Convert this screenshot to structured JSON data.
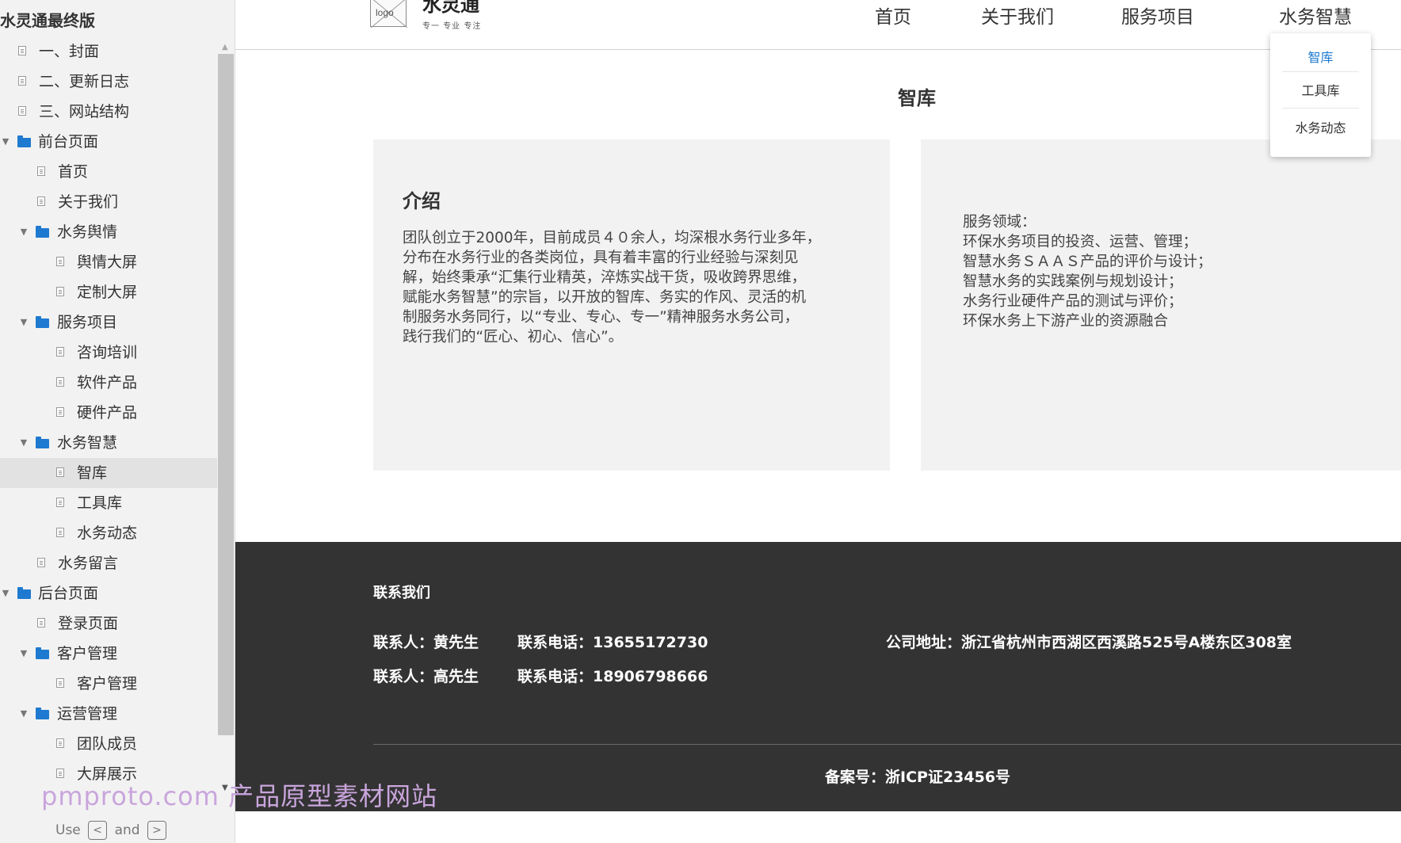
{
  "sidebar": {
    "title": "水灵通最终版",
    "items": [
      {
        "label": "一、封面"
      },
      {
        "label": "二、更新日志"
      },
      {
        "label": "三、网站结构"
      },
      {
        "label": "前台页面"
      },
      {
        "label": "首页"
      },
      {
        "label": "关于我们"
      },
      {
        "label": "水务舆情"
      },
      {
        "label": "舆情大屏"
      },
      {
        "label": "定制大屏"
      },
      {
        "label": "服务项目"
      },
      {
        "label": "咨询培训"
      },
      {
        "label": "软件产品"
      },
      {
        "label": "硬件产品"
      },
      {
        "label": "水务智慧"
      },
      {
        "label": "智库"
      },
      {
        "label": "工具库"
      },
      {
        "label": "水务动态"
      },
      {
        "label": "水务留言"
      },
      {
        "label": "后台页面"
      },
      {
        "label": "登录页面"
      },
      {
        "label": "客户管理"
      },
      {
        "label": "客户管理"
      },
      {
        "label": "运营管理"
      },
      {
        "label": "团队成员"
      },
      {
        "label": "大屏展示"
      }
    ],
    "active_item": "智库",
    "hint": {
      "use": "Use",
      "and": "and",
      "key_prev": "<",
      "key_next": ">"
    }
  },
  "watermark": "pmproto.com 产品原型素材网站",
  "header": {
    "logo_text": "logo",
    "brand_name": "水灵通",
    "slogan": "专一 专业 专注",
    "nav": [
      {
        "label": "首页"
      },
      {
        "label": "关于我们"
      },
      {
        "label": "服务项目"
      },
      {
        "label": "水务智慧"
      }
    ],
    "dropdown": [
      {
        "label": "智库",
        "active": true
      },
      {
        "label": "工具库"
      },
      {
        "label": "水务动态"
      }
    ]
  },
  "main": {
    "page_title": "智库",
    "intro": {
      "heading": "介绍",
      "lines": [
        "团队创立于2000年，目前成员４０余人，均深根水务行业多年，",
        "分布在水务行业的各类岗位，具有着丰富的行业经验与深刻见",
        "解，始终秉承“汇集行业精英，淬炼实战干货，吸收跨界思维，",
        "赋能水务智慧”的宗旨，以开放的智库、务实的作风、灵活的机",
        "制服务水务同行，以“专业、专心、专一”精神服务水务公司，",
        "践行我们的“匠心、初心、信心”。"
      ]
    },
    "services": {
      "lines": [
        "服务领域：",
        "环保水务项目的投资、运营、管理；",
        "智慧水务ＳＡＡＳ产品的评价与设计；",
        "智慧水务的实践案例与规划设计；",
        "水务行业硬件产品的测试与评价；",
        "环保水务上下游产业的资源融合"
      ]
    }
  },
  "footer": {
    "title": "联系我们",
    "contacts": [
      {
        "person": "联系人：黄先生",
        "phone": "联系电话：13655172730"
      },
      {
        "person": "联系人：高先生",
        "phone": "联系电话：18906798666"
      }
    ],
    "address": "公司地址：浙江省杭州市西湖区西溪路525号A楼东区308室",
    "icp": "备案号：浙ICP证23456号"
  },
  "colors": {
    "accent": "#1e7ad0",
    "footer_bg": "#333333",
    "card_bg": "#f2f2f2",
    "sidebar_bg": "#f2f2f2"
  }
}
